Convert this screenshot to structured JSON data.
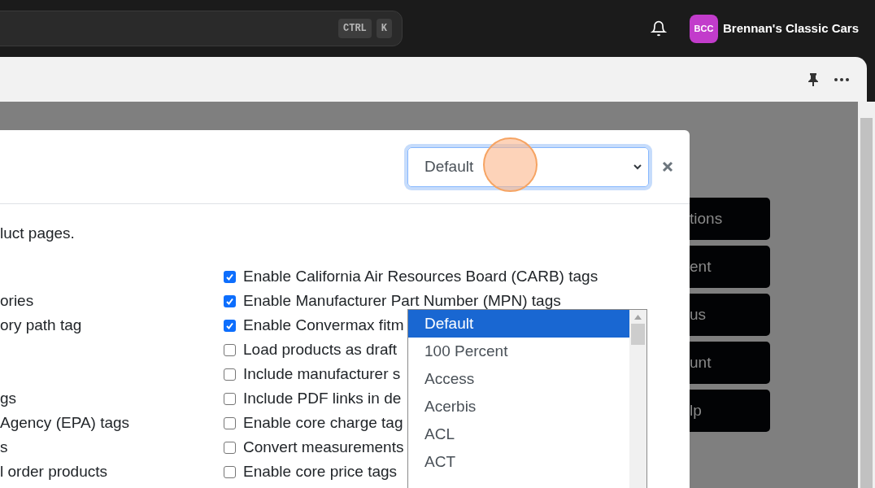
{
  "top_bar": {
    "shortcut_keys": [
      "CTRL",
      "K"
    ],
    "account": {
      "initials": "BCC",
      "name": "Brennan's Classic Cars"
    }
  },
  "background_buttons": [
    "tions",
    "ent",
    "us",
    "unt",
    "lp"
  ],
  "modal": {
    "select_value": "Default",
    "description": "luct pages.",
    "rows": [
      {
        "right": {
          "label": "Enable California Air Resources Board (CARB) tags",
          "checked": true
        }
      },
      {
        "left": "ories",
        "right": {
          "label": "Enable Manufacturer Part Number (MPN) tags",
          "checked": true
        }
      },
      {
        "left": "ory path tag",
        "right": {
          "label": "Enable Convermax fitm",
          "checked": true
        }
      },
      {
        "right": {
          "label": "Load products as draft",
          "checked": false
        }
      },
      {
        "right": {
          "label": "Include manufacturer s",
          "checked": false
        }
      },
      {
        "left": "gs",
        "right": {
          "label": "Include PDF links in de",
          "checked": false
        }
      },
      {
        "left": "Agency (EPA) tags",
        "right": {
          "label": "Enable core charge tag",
          "checked": false
        }
      },
      {
        "left": "s",
        "right": {
          "label": "Convert measurements",
          "checked": false
        }
      },
      {
        "left": "l order products",
        "right": {
          "label": "Enable core price tags",
          "checked": false
        }
      }
    ],
    "dropdown": [
      {
        "label": "Default",
        "selected": true
      },
      {
        "label": "100 Percent",
        "selected": false
      },
      {
        "label": "Access",
        "selected": false
      },
      {
        "label": "Acerbis",
        "selected": false
      },
      {
        "label": "ACL",
        "selected": false
      },
      {
        "label": "ACT",
        "selected": false
      }
    ]
  }
}
